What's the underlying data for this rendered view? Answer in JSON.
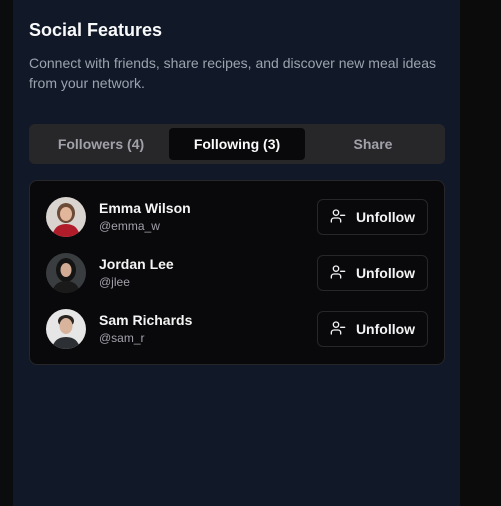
{
  "section": {
    "title": "Social Features",
    "description": "Connect with friends, share recipes, and discover new meal ideas from your network."
  },
  "tabs": [
    {
      "label": "Followers (4)",
      "active": false
    },
    {
      "label": "Following (3)",
      "active": true
    },
    {
      "label": "Share",
      "active": false
    }
  ],
  "following": [
    {
      "name": "Emma Wilson",
      "handle": "@emma_w",
      "action": "Unfollow",
      "icon": "user-minus-icon"
    },
    {
      "name": "Jordan Lee",
      "handle": "@jlee",
      "action": "Unfollow",
      "icon": "user-minus-icon"
    },
    {
      "name": "Sam Richards",
      "handle": "@sam_r",
      "action": "Unfollow",
      "icon": "user-minus-icon"
    }
  ],
  "colors": {
    "panel_bg": "#111827",
    "page_bg": "#0b0c0e",
    "card_bg": "#09090b",
    "tab_track": "#27272a",
    "muted_text": "#9ca3af"
  }
}
